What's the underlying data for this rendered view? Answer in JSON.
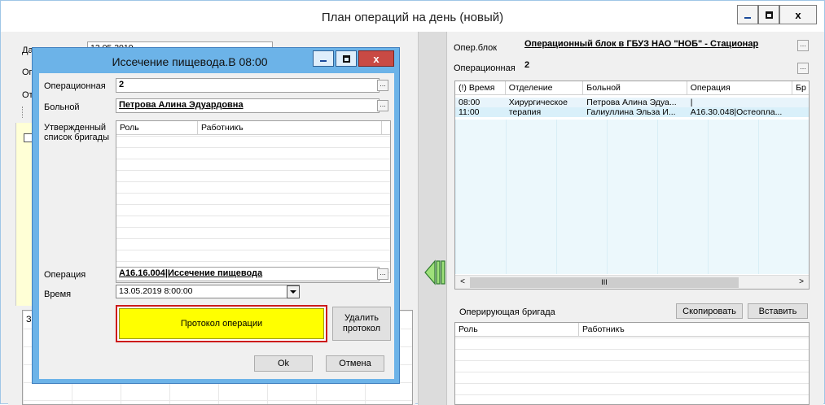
{
  "main": {
    "title": "План операций на день (новый)",
    "left": {
      "date_label": "Дата",
      "date_value": "13.05.2019",
      "op_label_short": "Оп",
      "ot_label_short": "От",
      "bottom_label_short": "З"
    },
    "right": {
      "oper_block_label": "Опер.блок",
      "oper_block_value": "Операционный блок в ГБУЗ НАО \"НОБ\" - Стационар",
      "operating_room_label": "Операционная",
      "operating_room_value": "2",
      "schedule": {
        "columns": [
          "(!) Время",
          "Отделение",
          "Больной",
          "Операция",
          "Бр"
        ],
        "rows": [
          [
            "08:00",
            "Хирургическое",
            "Петрова Алина Эдуа...",
            "|",
            ""
          ],
          [
            "11:00",
            "терапия",
            "Галиуллина Эльза И...",
            "А16.30.048|Остеопла...",
            ""
          ]
        ],
        "scroll_mid": "III"
      },
      "team_label": "Оперирующая бригада",
      "copy_button": "Скопировать",
      "paste_button": "Вставить",
      "team_columns": [
        "Роль",
        "Работникъ"
      ]
    }
  },
  "dialog": {
    "title": "Иссечение пищевода.В 08:00",
    "operating_room_label": "Операционная",
    "operating_room_value": "2",
    "patient_label": "Больной",
    "patient_value": "Петрова Алина Эдуардовна",
    "team_label": "Утвержденный список бригады",
    "team_columns": [
      "Роль",
      "Работникъ"
    ],
    "operation_label": "Операция",
    "operation_value": "А16.16.004|Иссечение пищевода",
    "time_label": "Время",
    "time_value": "13.05.2019 8:00:00",
    "protocol_button": "Протокол операции",
    "delete_protocol_button": "Удалить протокол",
    "ok_button": "Ok",
    "cancel_button": "Отмена"
  },
  "colors": {
    "dialog_frame": "#6cb3e8",
    "protocol_fill": "#ffff00",
    "protocol_border": "#cc1a1a",
    "selected_row": "#e8f4fb",
    "second_row": "#d9f0fa"
  }
}
